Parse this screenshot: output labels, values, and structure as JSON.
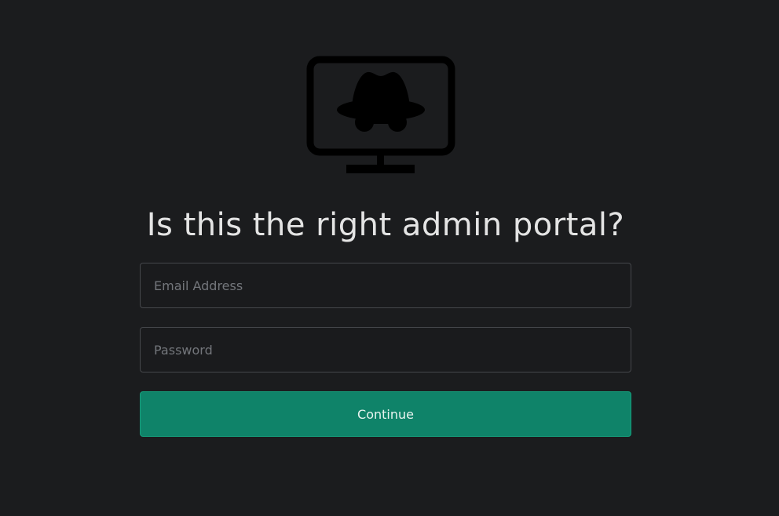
{
  "heading": "Is this the right admin portal?",
  "form": {
    "email_placeholder": "Email Address",
    "password_placeholder": "Password",
    "continue_label": "Continue"
  },
  "logo": {
    "icon": "incognito-monitor-icon"
  },
  "colors": {
    "background": "#1b1c1e",
    "accent": "#0f8369",
    "text": "#e4e4e4"
  }
}
